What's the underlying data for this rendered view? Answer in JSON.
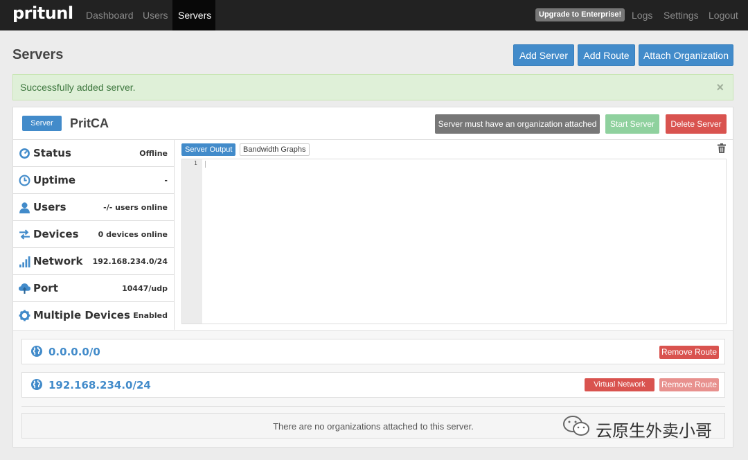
{
  "navbar": {
    "brand": "pritunl",
    "links": [
      {
        "label": "Dashboard"
      },
      {
        "label": "Users"
      },
      {
        "label": "Servers"
      }
    ],
    "upgrade_label": "Upgrade to Enterprise!",
    "right_links": [
      {
        "label": "Logs"
      },
      {
        "label": "Settings"
      },
      {
        "label": "Logout"
      }
    ]
  },
  "header": {
    "title": "Servers",
    "buttons": {
      "add_server": "Add Server",
      "add_route": "Add Route",
      "attach_org": "Attach Organization"
    }
  },
  "alert": {
    "message": "Successfully added server.",
    "close": "×"
  },
  "server": {
    "badge": "Server",
    "name": "PritCA",
    "warning_button": "Server must have an organization attached",
    "start_button": "Start Server",
    "delete_button": "Delete Server",
    "stats": [
      {
        "label": "Status",
        "value": "Offline",
        "icon": "status-icon"
      },
      {
        "label": "Uptime",
        "value": "-",
        "icon": "clock-icon"
      },
      {
        "label": "Users",
        "value": "-/- users online",
        "icon": "user-icon"
      },
      {
        "label": "Devices",
        "value": "0 devices online",
        "icon": "transfer-icon"
      },
      {
        "label": "Network",
        "value": "192.168.234.0/24",
        "icon": "signal-icon"
      },
      {
        "label": "Port",
        "value": "10447/udp",
        "icon": "cloud-upload-icon"
      },
      {
        "label": "Multiple Devices",
        "value": "Enabled",
        "icon": "cog-icon"
      }
    ],
    "tabs": {
      "output": "Server Output",
      "bandwidth": "Bandwidth Graphs"
    },
    "editor": {
      "line_number": "1"
    },
    "routes": [
      {
        "network": "0.0.0.0/0",
        "remove": "Remove Route"
      },
      {
        "network": "192.168.234.0/24",
        "virtual": "Virtual Network",
        "remove": "Remove Route"
      }
    ],
    "no_orgs": "There are no organizations attached to this server."
  },
  "watermark": {
    "text": "云原生外卖小哥"
  },
  "colors": {
    "primary": "#428bca",
    "danger": "#d9534f",
    "success_disabled": "#8fd19e",
    "navbar": "#222222"
  }
}
